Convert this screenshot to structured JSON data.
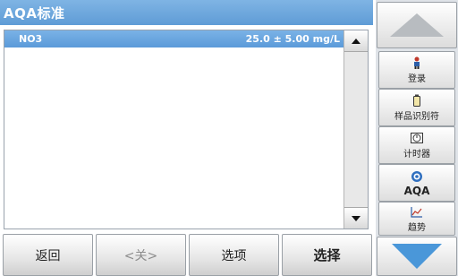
{
  "header": {
    "title": "AQA标准"
  },
  "list": {
    "rows": [
      {
        "name": "NO3",
        "value": "25.0 ±  5.00  mg/L"
      }
    ]
  },
  "bottom_buttons": [
    {
      "label": "返回",
      "enabled": true
    },
    {
      "label": "<关>",
      "enabled": false
    },
    {
      "label": "选项",
      "enabled": true
    },
    {
      "label": "选择",
      "enabled": true
    }
  ],
  "side_buttons": [
    {
      "label": "登录",
      "icon": "user-icon"
    },
    {
      "label": "样品识别符",
      "icon": "sample-bottle-icon"
    },
    {
      "label": "计时器",
      "icon": "timer-icon"
    },
    {
      "label": "AQA",
      "icon": "aqa-icon"
    },
    {
      "label": "趋势",
      "icon": "trend-chart-icon"
    }
  ],
  "colors": {
    "accent": "#5f9cd6",
    "arrow_down": "#4a97d9"
  }
}
